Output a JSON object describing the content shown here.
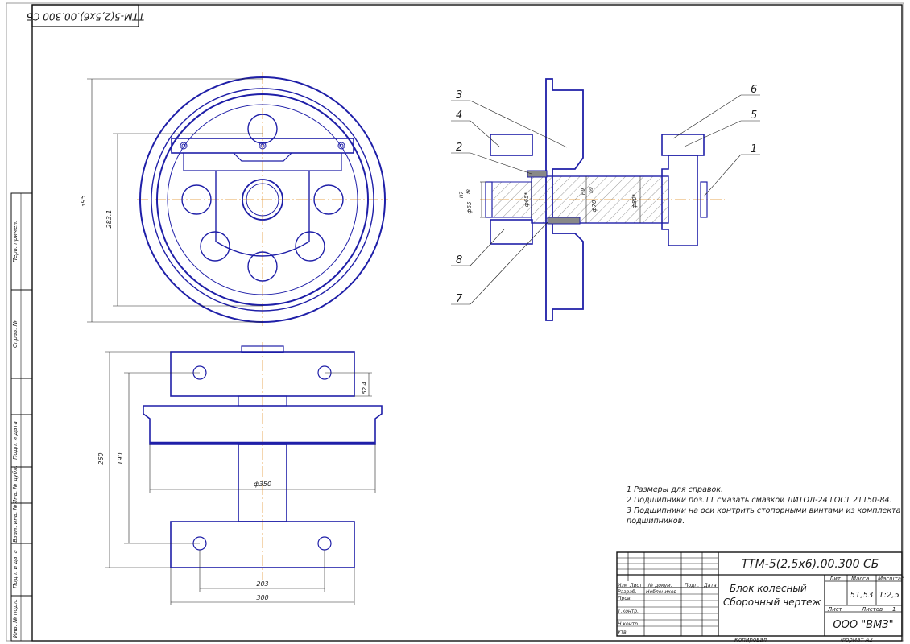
{
  "stamp_rotated": "ТТМ-5(2,5х6).00.300 СБ",
  "views": {
    "front_dims": {
      "outer": "395",
      "inner": "283.1"
    },
    "top_dims": {
      "overall": "260",
      "span": "190",
      "dia": "ф350",
      "step": "52.4",
      "holes": "203",
      "width": "300"
    },
    "section_dims": {
      "d1": "ф65",
      "fit1": "H7",
      "fit1b": "f8",
      "d2": "ф65*",
      "d3": "ф70",
      "fit3": "H9",
      "fit3b": "h9",
      "d4": "ф80*"
    },
    "callouts": [
      "1",
      "2",
      "3",
      "4",
      "5",
      "6",
      "7",
      "8"
    ]
  },
  "notes": [
    "1 Размеры для справок.",
    "2 Подшипники поз.11  смазать смазкой ЛИТОЛ-24 ГОСТ 21150-84.",
    "3 Подшипники на оси контрить стопорными винтами из комплекта",
    "подшипников."
  ],
  "title_block": {
    "designation": "ТТМ-5(2,5х6).00.300 СБ",
    "name_line1": "Блок колесный",
    "name_line2": "Сборочный чертеж",
    "col_lit": "Лит",
    "col_mass": "Масса",
    "col_scale": "Масштаб",
    "mass": "51,53",
    "scale": "1:2,5",
    "sheet_label": "Лист",
    "sheets_label": "Листов",
    "sheets": "1",
    "org": "ООО \"ВМЗ\"",
    "rows": [
      "Изм",
      "Лист",
      "№ докум.",
      "Подп.",
      "Дата"
    ],
    "roles": [
      "Разраб.",
      "Пров.",
      "Т.контр.",
      "Н.контр.",
      "Утв."
    ],
    "developer": "Неблеников",
    "copied": "Копировал",
    "format": "Формат  А2"
  },
  "left_strip": [
    "Перв. примен.",
    "Справ. №",
    "Подп. и дата",
    "Инв. № дубл.",
    "Взам. инв. №",
    "Подп. и дата",
    "Инв. № подл."
  ]
}
